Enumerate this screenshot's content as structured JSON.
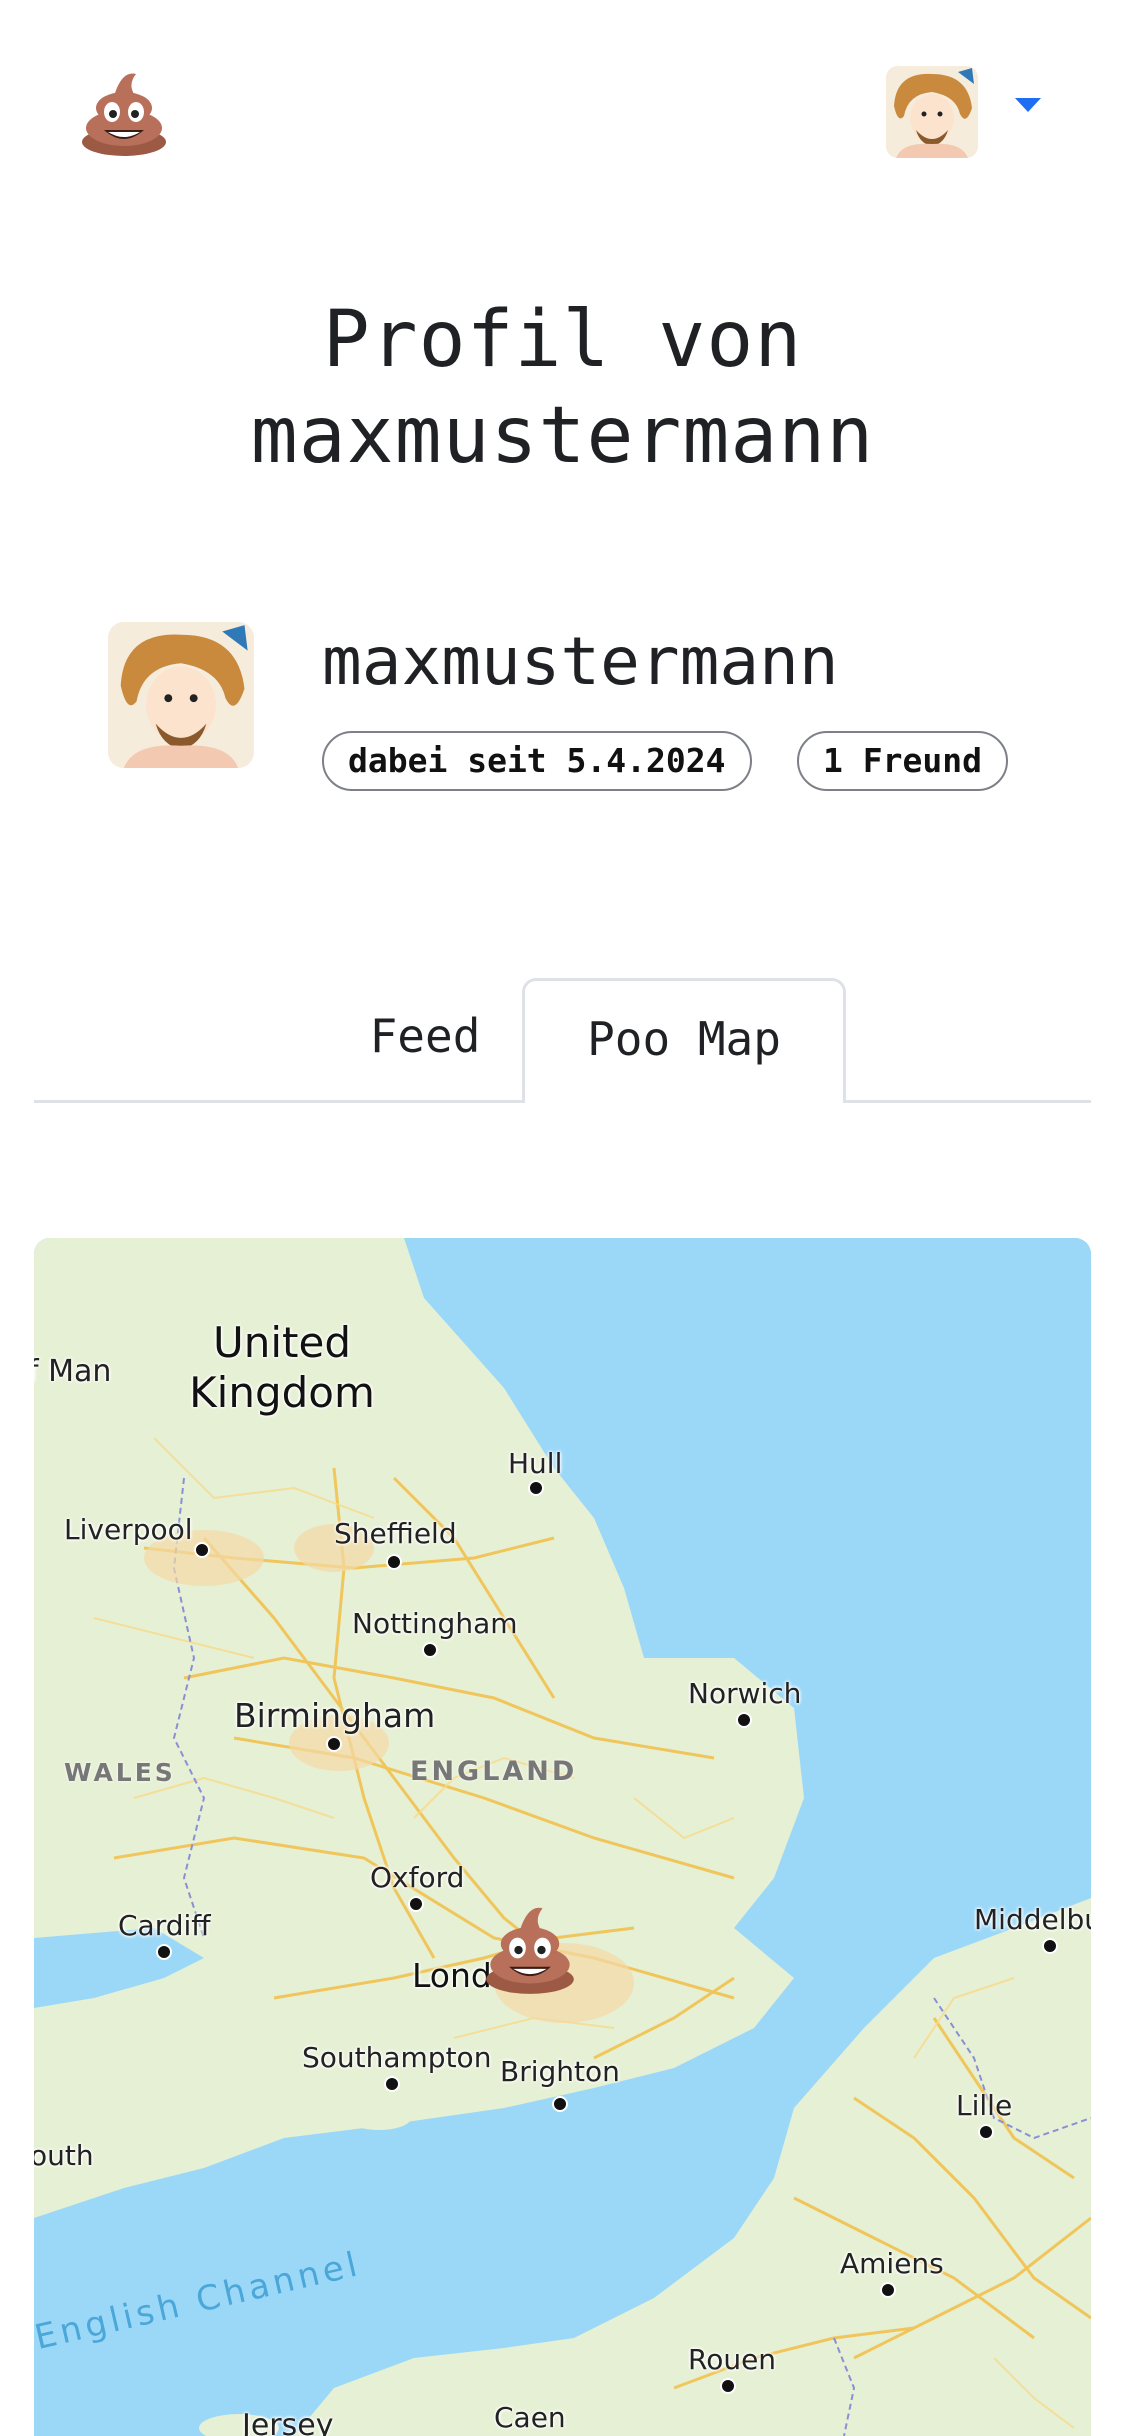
{
  "header": {
    "logo_icon": "poo-emoji-icon",
    "avatar_icon": "caveman-avatar-icon",
    "menu_icon": "chevron-down-icon",
    "accent_color": "#1d6ef2"
  },
  "page": {
    "title": "Profil von maxmustermann"
  },
  "profile": {
    "username": "maxmustermann",
    "member_since": "dabei seit 5.4.2024",
    "friends": "1 Freund"
  },
  "tabs": {
    "items": [
      {
        "label": "Feed",
        "active": false
      },
      {
        "label": "Poo Map",
        "active": true
      }
    ]
  },
  "map": {
    "marker_icon": "poo-emoji-icon",
    "labels": {
      "uk": "United Kingdom",
      "isle_of_man": "f Man",
      "hull": "Hull",
      "liverpool": "Liverpool",
      "sheffield": "Sheffield",
      "nottingham": "Nottingham",
      "norwich": "Norwich",
      "birmingham": "Birmingham",
      "wales": "WALES",
      "england": "ENGLAND",
      "oxford": "Oxford",
      "cardiff": "Cardiff",
      "london": "Londo",
      "middelburg": "Middelbu",
      "southampton": "Southampton",
      "brighton": "Brighton",
      "lille": "Lille",
      "plymouth": "outh",
      "english_channel": "English Channel",
      "amiens": "Amiens",
      "rouen": "Rouen",
      "jersey": "Jersey",
      "caen": "Caen"
    },
    "colors": {
      "sea": "#9bd8f8",
      "land": "#e6f0d4",
      "roads": "#f2c14e",
      "border": "#8a8fd6"
    }
  }
}
